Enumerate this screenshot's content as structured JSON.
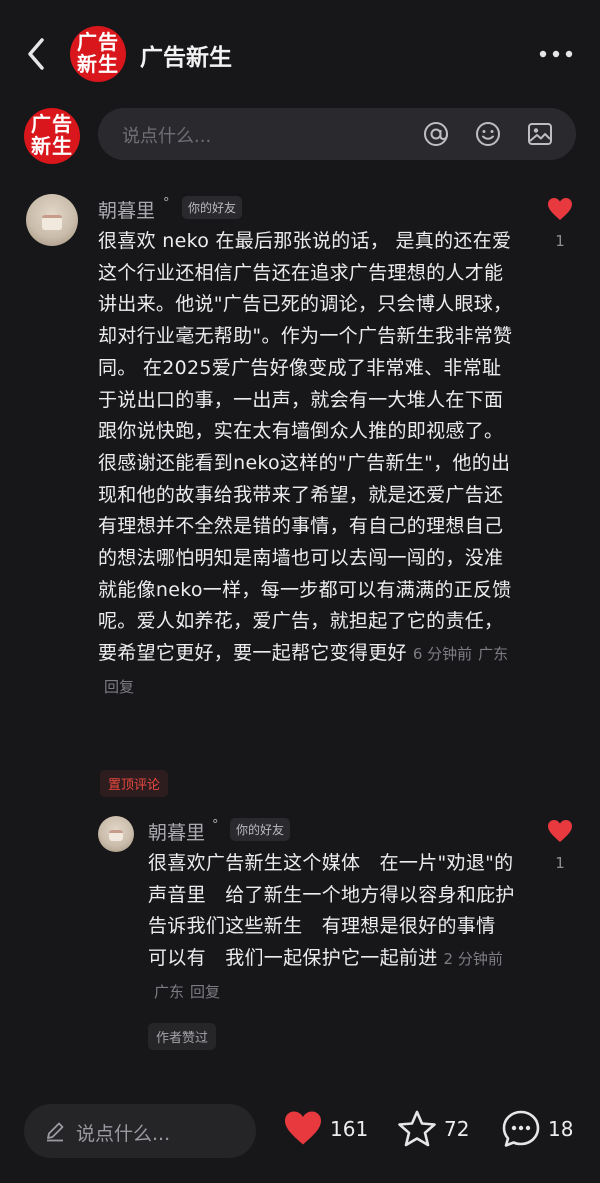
{
  "header": {
    "title": "广告新生",
    "logo_text": [
      "广告",
      "新生"
    ]
  },
  "composer": {
    "placeholder": "说点什么..."
  },
  "comments": [
    {
      "username": "朝暮里",
      "badge": "你的好友",
      "text": "很喜欢 neko 在最后那张说的话， 是真的还在爱这个行业还相信广告还在追求广告理想的人才能讲出来。他说\"广告已死的调论，只会博人眼球，却对行业毫无帮助\"。作为一个广告新生我非常赞同。 在2025爱广告好像变成了非常难、非常耻于说出口的事，一出声，就会有一大堆人在下面跟你说快跑，实在太有墙倒众人推的即视感了。很感谢还能看到neko这样的\"广告新生\"，他的出现和他的故事给我带来了希望，就是还爱广告还有理想并不全然是错的事情，有自己的理想自己的想法哪怕明知是南墙也可以去闯一闯的，没准就能像neko一样，每一步都可以有满满的正反馈呢。爱人如养花，爱广告，就担起了它的责任，要希望它更好，要一起帮它变得更好",
      "time": "6 分钟前",
      "location": "广东",
      "reply": "回复",
      "likes": "1",
      "tag": "置顶评论"
    },
    {
      "username": "朝暮里",
      "badge": "你的好友",
      "text": "很喜欢广告新生这个媒体　在一片\"劝退\"的声音里　给了新生一个地方得以容身和庇护　 告诉我们这些新生　有理想是很好的事情　可以有　我们一起保护它一起前进",
      "time": "2 分钟前",
      "location": "广东",
      "reply": "回复",
      "likes": "1",
      "tag": "作者赞过"
    }
  ],
  "bottom_bar": {
    "placeholder": "说点什么...",
    "likes": "161",
    "favorites": "72",
    "comments": "18"
  },
  "colors": {
    "background": "#17171a",
    "accent": "#e8393f",
    "brand": "#d8161b"
  },
  "icons": [
    "back-icon",
    "more-icon",
    "at-icon",
    "emoji-icon",
    "image-icon",
    "heart-icon",
    "star-icon",
    "comment-icon",
    "pencil-icon"
  ]
}
